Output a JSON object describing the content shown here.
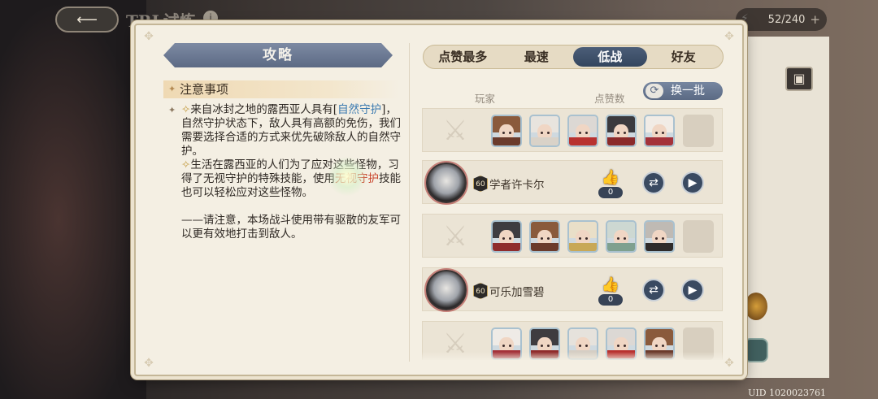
{
  "header": {
    "title": "TRL试炼",
    "back_icon": "back-arrow-icon",
    "stamina": "52/240",
    "stamina_plus": "+"
  },
  "uid": "UID 1020023761",
  "guide": {
    "title": "攻略",
    "notes_title": "注意事项",
    "para1": {
      "pre": "来自冰封之地的露西亚人具有[",
      "hl1": "自然守护",
      "post": "]，自然守护状态下，敌人具有高额的免伤，我们需要选择合适的方式来优先破除敌人的自然守护。"
    },
    "para2": {
      "pre": "生活在露西亚的人们为了应对这些怪物，习得了无视守护的特殊技能，使用",
      "hl1": "无视守护",
      "post": "技能也可以轻松应对这些怪物。"
    },
    "para3": "——请注意，本场战斗使用带有驱散的友军可以更有效地打击到敌人。"
  },
  "tabs": [
    {
      "label": "点赞最多",
      "active": false
    },
    {
      "label": "最速",
      "active": false
    },
    {
      "label": "低战",
      "active": true
    },
    {
      "label": "好友",
      "active": false
    }
  ],
  "columns": {
    "player": "玩家",
    "likes": "点赞数"
  },
  "refresh_label": "换一批",
  "players": [
    {
      "level": "60",
      "name": "学者许卡尔",
      "likes": "0"
    },
    {
      "level": "60",
      "name": "可乐加雪碧",
      "likes": "0"
    }
  ],
  "colors": {
    "accent": "#4c5e78",
    "highlight_blue": "#3b7ab0",
    "highlight_red": "#c9442c"
  }
}
